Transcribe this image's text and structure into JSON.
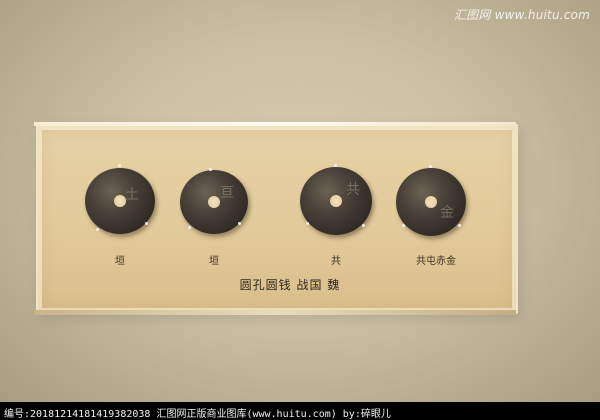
{
  "watermark_top": "汇图网 www.huitu.com",
  "coins": [
    {
      "label": "垣"
    },
    {
      "label": "垣"
    },
    {
      "label": "共"
    },
    {
      "label": "共屯赤金"
    }
  ],
  "caption": "圆孔圆钱 战国 魏",
  "bottom_bar": "编号:20181214181419382038  汇图网正版商业图库(www.huitu.com)  by:碎眼儿",
  "colors": {
    "wall": "#cbbfa5",
    "case_panel": "#e2cb9b",
    "coin_dark": "#332d27",
    "bar": "#000000"
  }
}
